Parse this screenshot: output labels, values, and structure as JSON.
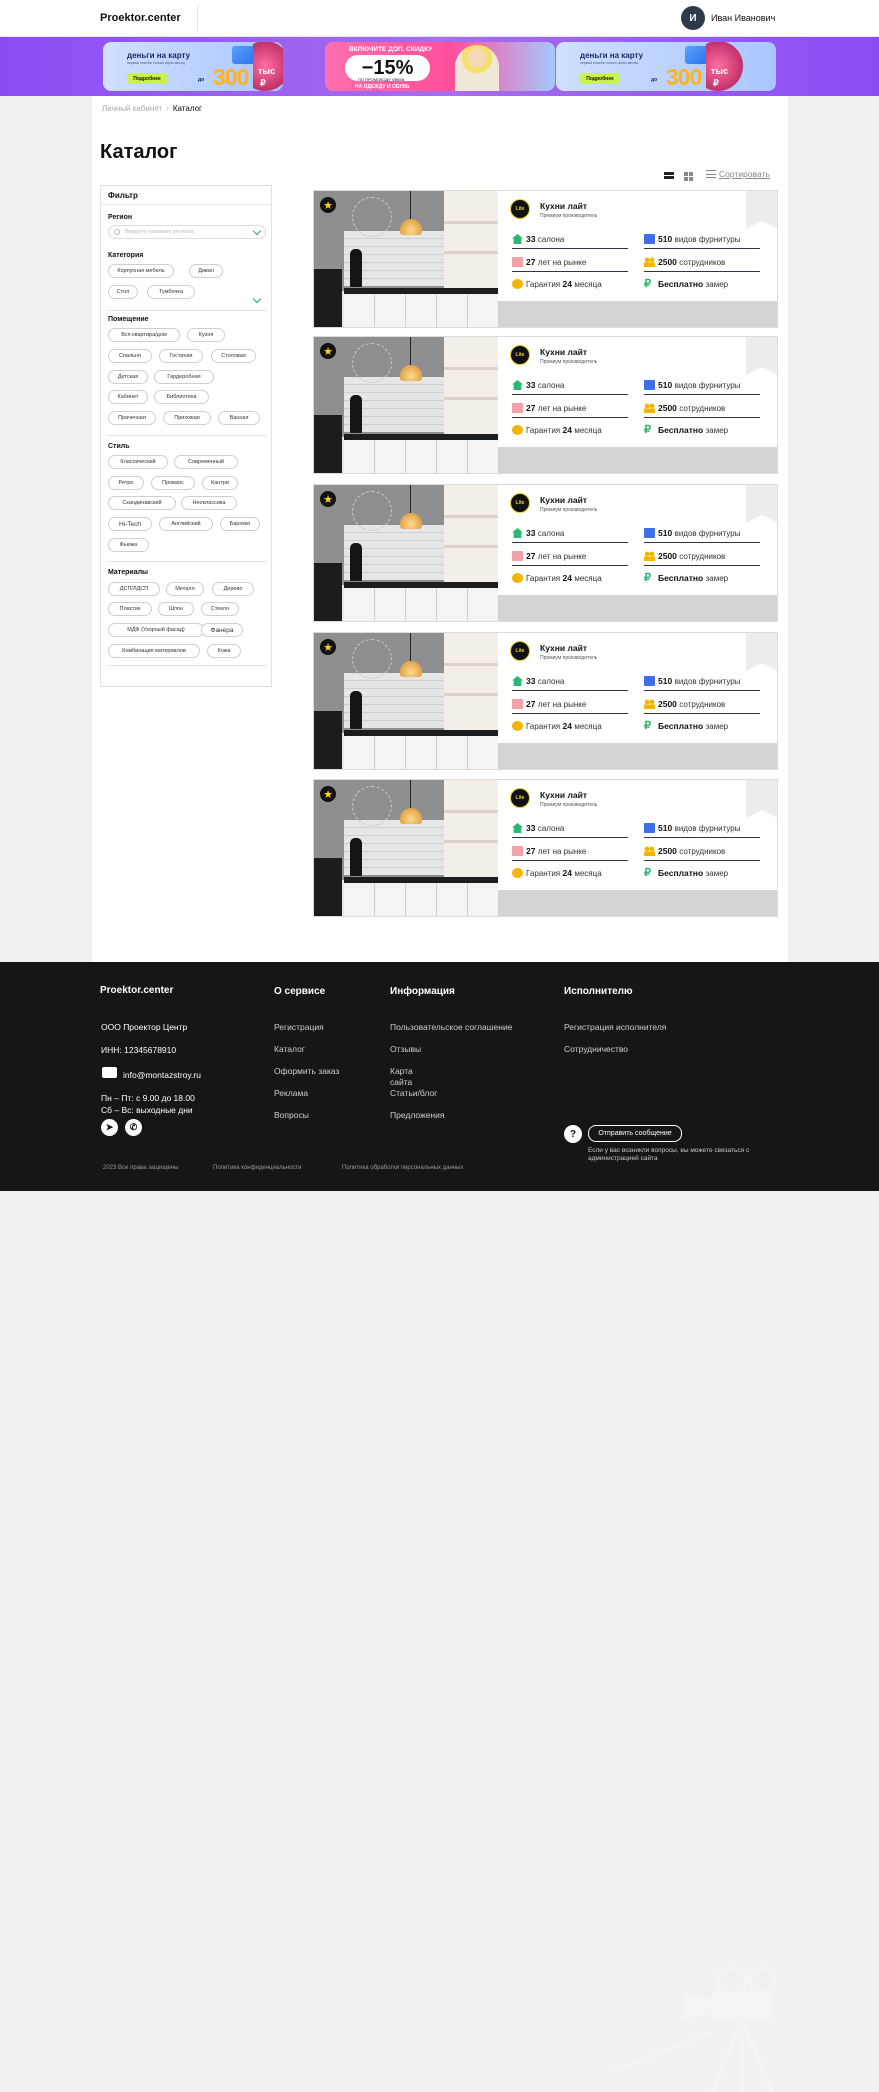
{
  "header": {
    "logo": "Proektor.center",
    "avatar_letter": "И",
    "user_name": "Иван Иванович"
  },
  "banner": {
    "ads": [
      {
        "title": "деньги на карту",
        "subtitle": "первый платёж только через месяц",
        "button": "Подробнее",
        "prefix": "до",
        "amount": "300",
        "unit": "тыс",
        "currency": "₽"
      },
      {
        "top": "ВКЛЮЧИТЕ ДОП. СКИДКУ",
        "discount": "−15%",
        "promo": "ПО ПРОМОКОДУ VBIMA",
        "bottom": "НА ОДЕЖДУ И ОБУВЬ"
      },
      {
        "title": "деньги на карту",
        "subtitle": "первый платёж только через месяц",
        "button": "Подробнее",
        "prefix": "до",
        "amount": "300",
        "unit": "тыс",
        "currency": "₽"
      }
    ]
  },
  "breadcrumb": {
    "parent": "Личный кабинет",
    "separator": "›",
    "current": "Каталог"
  },
  "page_title": "Каталог",
  "toolbar": {
    "sort_label": "Сортировать"
  },
  "filter": {
    "title": "Фильтр",
    "region_label": "Регион",
    "region_placeholder": "Введите название региона",
    "category_label": "Категория",
    "category_chips": [
      "Корпусная мебель",
      "Диван",
      "Стол",
      "Тумбочка"
    ],
    "room_label": "Помещение",
    "room_chips": [
      "Вся квартира/дом",
      "Кухня",
      "Спальня",
      "Гостиная",
      "Столовая",
      "Детская",
      "Гардеробная",
      "Кабинет",
      "Библиотека",
      "Прачечная",
      "Прихожая",
      "Ванная"
    ],
    "style_label": "Стиль",
    "style_chips": [
      "Классический",
      "Современный",
      "Ретро",
      "Прованс",
      "Кантри",
      "Скандинавский",
      "Неоклассика",
      "Hi-Tech",
      "Английский",
      "Барокко",
      "Фьюжн"
    ],
    "material_label": "Материалы",
    "material_chips": [
      "ДСП/ЛДСП",
      "Металл",
      "Дерево",
      "Пластик",
      "Шпон",
      "Стекло",
      "МДФ (Узорный фасад)",
      "Фанера",
      "Комбинация материалов",
      "Кожа"
    ]
  },
  "card_template": {
    "logo_text": "Lite",
    "name": "Кухни лайт",
    "subtitle": "Премиум производитель",
    "salons_num": "33",
    "salons_text": "салона",
    "years_num": "27",
    "years_text": "лет на рынке",
    "warranty_pre": "Гарантия",
    "warranty_num": "24",
    "warranty_text": "месяца",
    "fittings_num": "510",
    "fittings_text": "видов фурнитуры",
    "staff_num": "2500",
    "staff_text": "сотрудников",
    "measure_bold": "Бесплатно",
    "measure_text": "замер"
  },
  "cards_count": 5,
  "footer": {
    "logo": "Proektor.center",
    "company": "ООО Проектор Центр",
    "inn": "ИНН: 12345678910",
    "email": "info@montazstroy.ru",
    "hours1": "Пн – Пт: с 9.00 до 18.00",
    "hours2": "Сб – Вс: выходные дни",
    "col_service": {
      "title": "О сервисе",
      "links": [
        "Регистрация",
        "Каталог",
        "Оформить заказ",
        "Реклама",
        "Вопросы"
      ]
    },
    "col_info": {
      "title": "Информация",
      "links": [
        "Пользовательское соглашение",
        "Отзывы",
        "Карта сайта",
        "Статьи/блог",
        "Предложения"
      ]
    },
    "col_exec": {
      "title": "Исполнителю",
      "links": [
        "Регистрация исполнителя",
        "Сотрудничество"
      ]
    },
    "send_button": "Отправить сообщение",
    "help_text": "Если у вас возникли вопросы, вы можете связаться с администрацией сайта",
    "copyright": "2023 Все права защищены",
    "privacy": "Политика конфиденциальности",
    "personal": "Политика обработки персональных данных"
  }
}
